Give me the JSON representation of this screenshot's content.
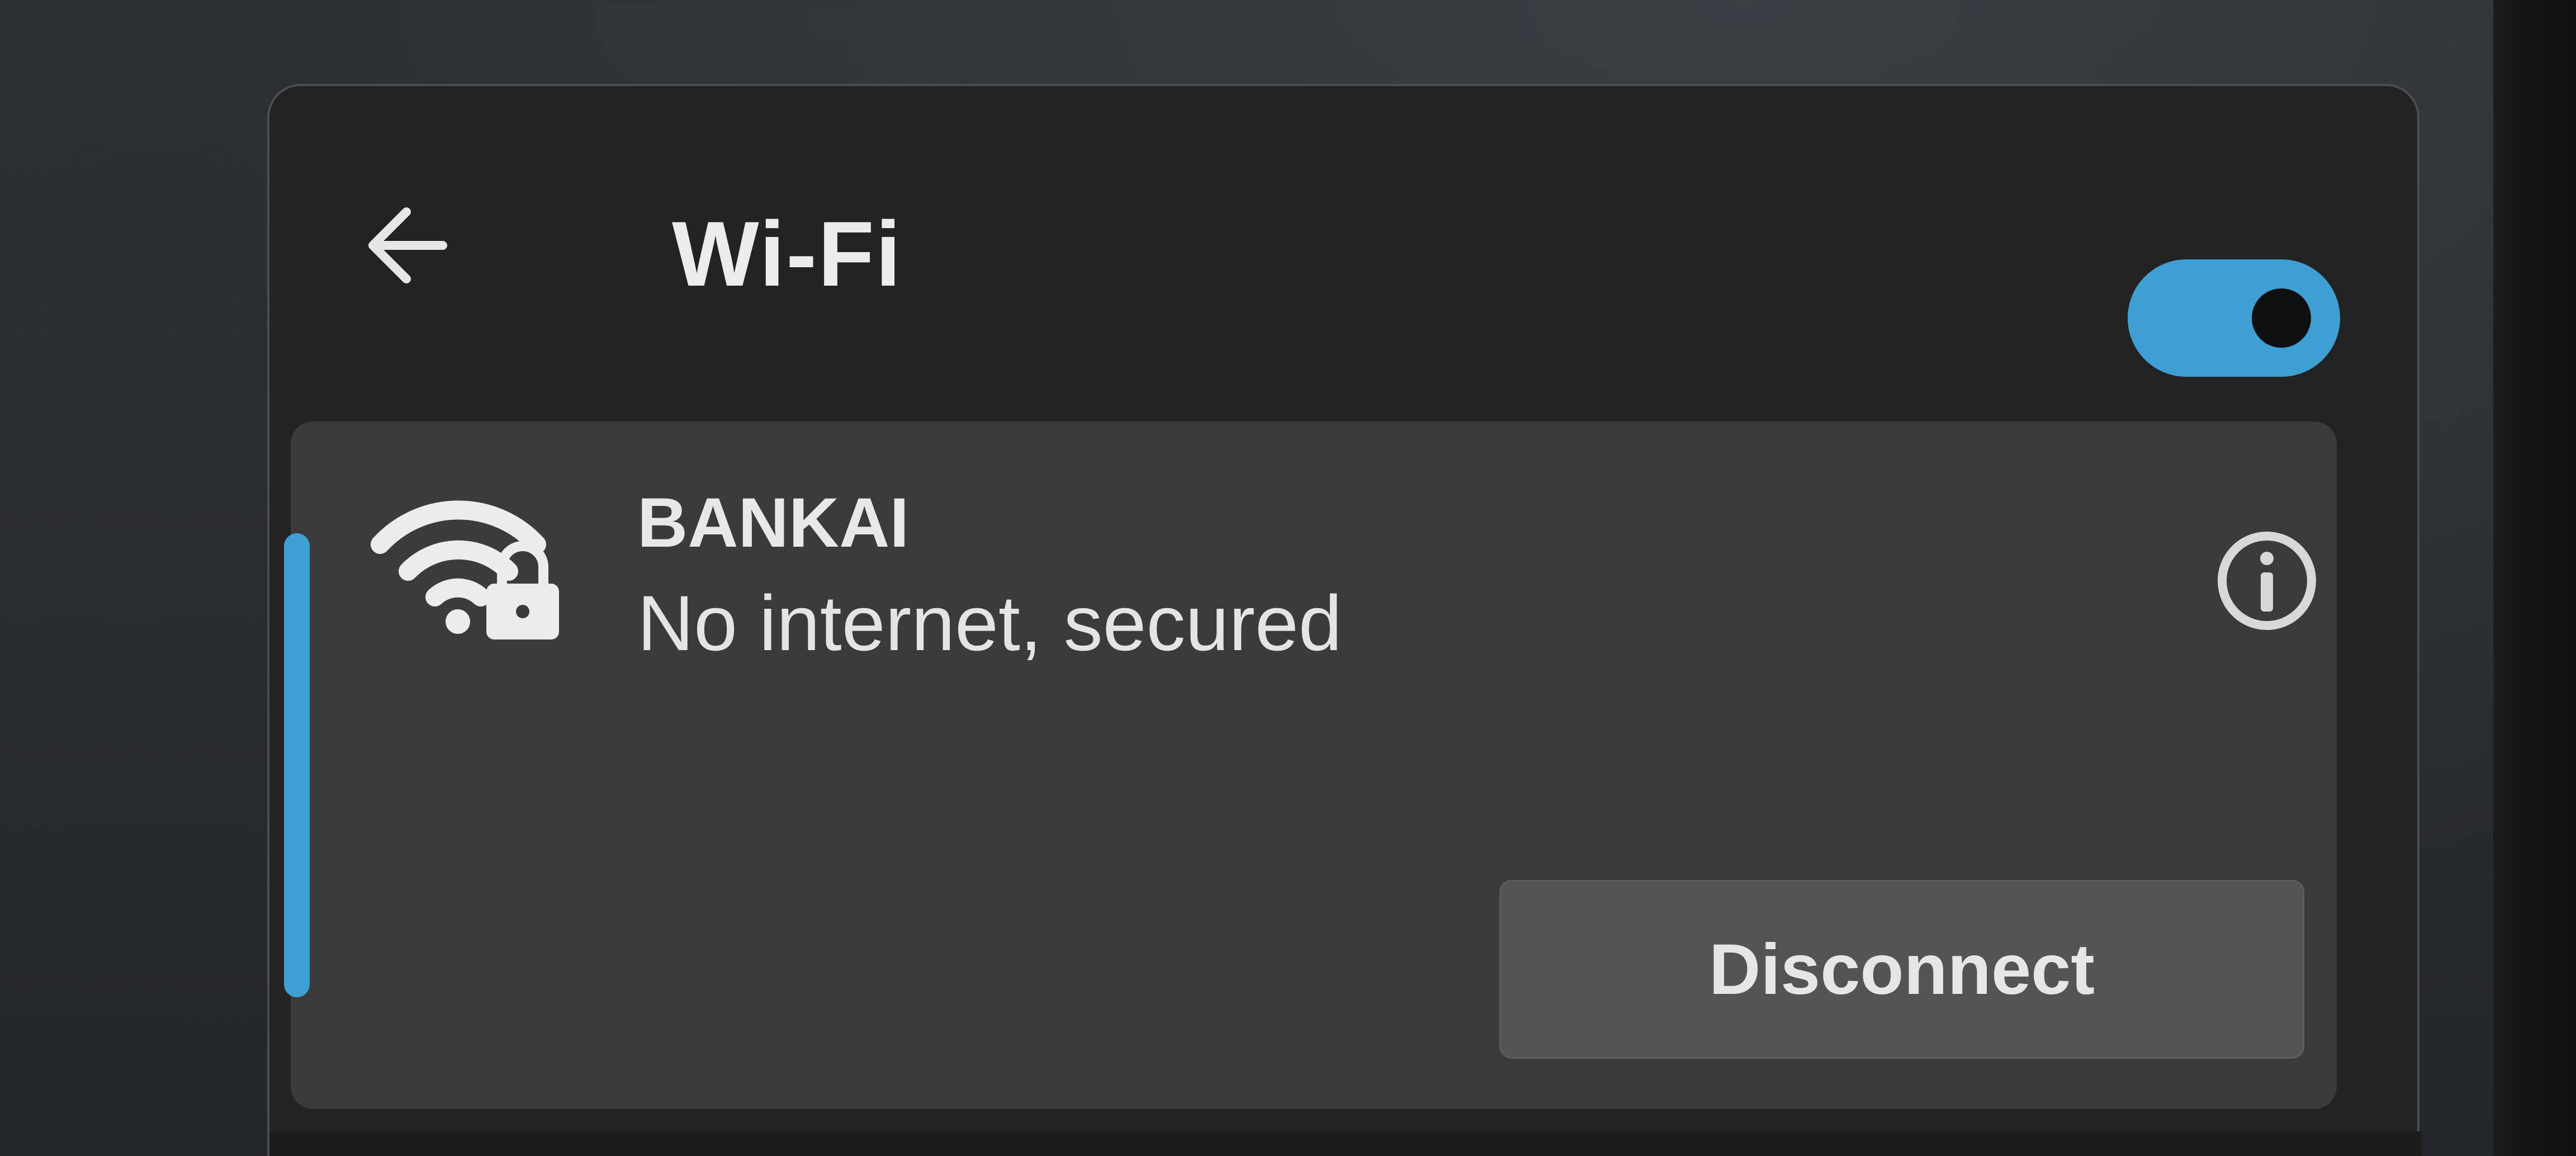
{
  "panel": {
    "title": "Wi-Fi",
    "back_icon": "arrow-left-icon",
    "wifi_toggle": {
      "state": "on",
      "accent_color": "#3e9fd3"
    }
  },
  "network": {
    "name": "BANKAI",
    "status": "No internet, secured",
    "signal_icon": "wifi-lock-icon",
    "info_icon": "info-icon",
    "connected": true,
    "disconnect_label": "Disconnect"
  },
  "colors": {
    "accent": "#3e9fd3",
    "panel_background": "#232323",
    "card_background": "#3b3b3b",
    "button_background": "#545454"
  }
}
